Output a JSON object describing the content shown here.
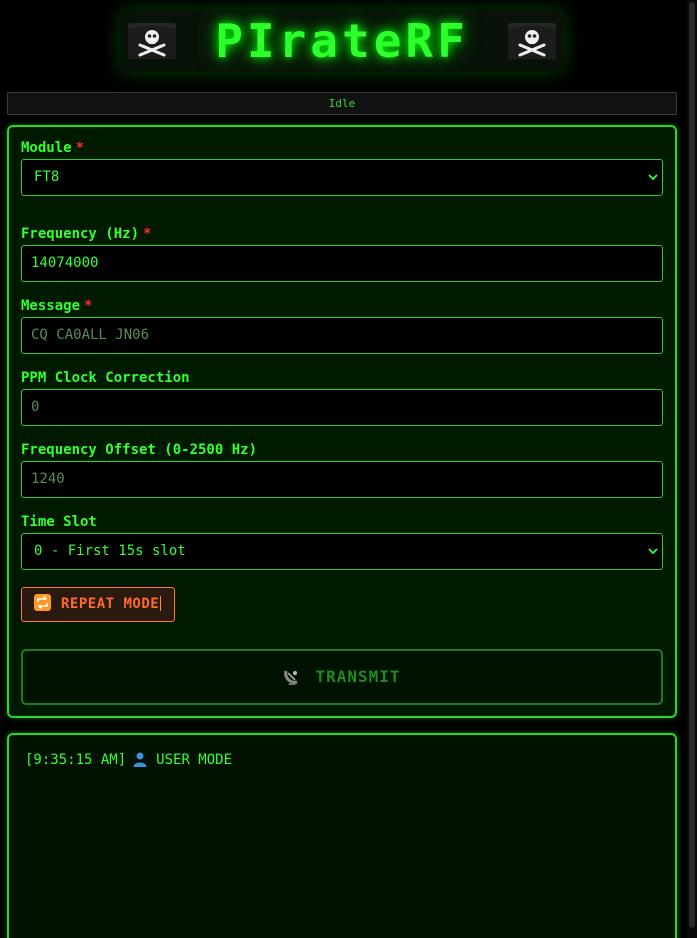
{
  "app": {
    "title": "PIrateRF",
    "status": "Idle"
  },
  "form": {
    "module": {
      "label": "Module",
      "required_mark": "*",
      "value": "FT8"
    },
    "frequency": {
      "label": "Frequency (Hz)",
      "required_mark": "*",
      "value": "14074000"
    },
    "message": {
      "label": "Message",
      "required_mark": "*",
      "placeholder": "CQ CA0ALL JN06"
    },
    "ppm": {
      "label": "PPM Clock Correction",
      "placeholder": "0"
    },
    "offset": {
      "label": "Frequency Offset (0-2500 Hz)",
      "placeholder": "1240"
    },
    "time_slot": {
      "label": "Time Slot",
      "value": "0 - First 15s slot"
    },
    "repeat_button": {
      "label": "REPEAT MODE",
      "icon": "repeat-icon"
    },
    "transmit_button": {
      "label": "TRANSMIT",
      "icon": "satellite-antenna-icon"
    }
  },
  "log": {
    "entries": [
      {
        "time": "[9:35:15 AM]",
        "icon": "user-icon",
        "text": "USER MODE"
      }
    ]
  },
  "colors": {
    "accent": "#2bff2b",
    "required": "#ff2a2a",
    "repeat": "#ff6a2a",
    "background": "#000000"
  }
}
